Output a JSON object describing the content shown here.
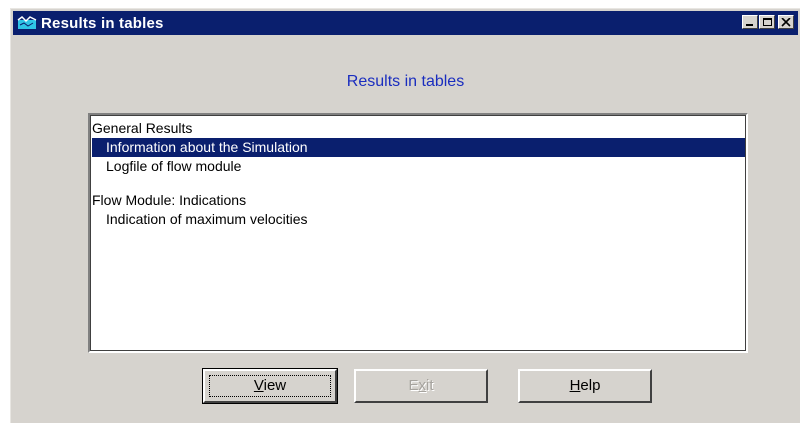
{
  "window": {
    "title": "Results in tables",
    "controls": {
      "minimize": "minimize",
      "maximize": "maximize",
      "close": "close"
    }
  },
  "heading": "Results in tables",
  "list": {
    "items": [
      {
        "label": "General Results",
        "level": 0,
        "selected": false
      },
      {
        "label": "Information about the Simulation",
        "level": 1,
        "selected": true
      },
      {
        "label": "Logfile of flow module",
        "level": 1,
        "selected": false
      },
      {
        "label": "",
        "level": 0,
        "selected": false
      },
      {
        "label": "Flow Module: Indications",
        "level": 0,
        "selected": false
      },
      {
        "label": "Indication of maximum velocities",
        "level": 1,
        "selected": false
      }
    ]
  },
  "buttons": {
    "view": {
      "mnemonic": "V",
      "rest": "iew"
    },
    "exit": {
      "first": "E",
      "mnemonic": "x",
      "rest": "it"
    },
    "help": {
      "mnemonic": "H",
      "rest": "elp"
    }
  },
  "colors": {
    "titlebar": "#0a1f6e",
    "heading": "#1a2dbf",
    "face": "#d6d3ce",
    "selection": "#0a1f6e"
  }
}
